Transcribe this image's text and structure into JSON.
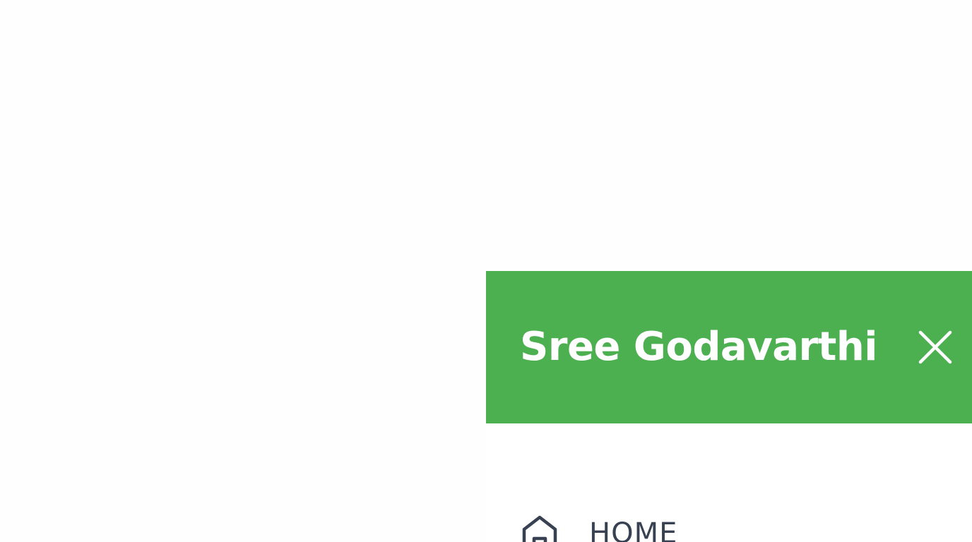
{
  "drawer": {
    "header": {
      "title": "Sree Godavarthi",
      "background_color": "#4caf50",
      "text_color": "#ffffff",
      "close_icon": "close-icon"
    },
    "nav": {
      "text_color": "#374151",
      "items": [
        {
          "label": "HOME",
          "icon": "home-icon"
        }
      ]
    }
  }
}
